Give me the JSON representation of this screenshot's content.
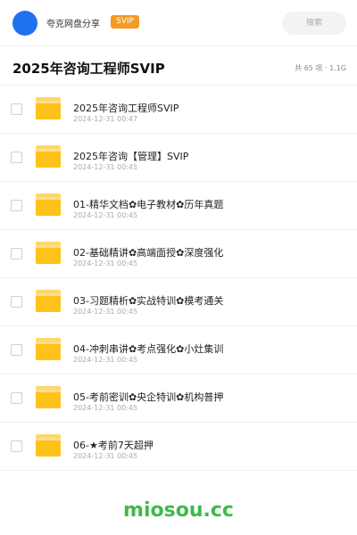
{
  "header": {
    "brand_name": "夸克网盘分享",
    "vip_badge": "SVIP",
    "search_label": "搜索"
  },
  "title_row": {
    "title": "2025年咨询工程师SVIP",
    "meta": "共 65 项 · 1.1G"
  },
  "files": [
    {
      "name": "2025年咨询工程师SVIP",
      "date": "2024-12-31 00:47"
    },
    {
      "name": "2025年咨询【管理】SVIP",
      "date": "2024-12-31 00:45"
    },
    {
      "name": "01-精华文档✿电子教材✿历年真题",
      "date": "2024-12-31 00:45"
    },
    {
      "name": "02-基础精讲✿高端面授✿深度强化",
      "date": "2024-12-31 00:45"
    },
    {
      "name": "03-习题精析✿实战特训✿模考通关",
      "date": "2024-12-31 00:45"
    },
    {
      "name": "04-冲刺串讲✿考点强化✿小灶集训",
      "date": "2024-12-31 00:45"
    },
    {
      "name": "05-考前密训✿央企特训✿机构普押",
      "date": "2024-12-31 00:45"
    },
    {
      "name": "06-★考前7天超押",
      "date": "2024-12-31 00:45"
    }
  ],
  "watermark": "miosou.cc",
  "colors": {
    "accent_blue": "#1e72f0",
    "vip_orange": "#f59a23",
    "folder_yellow": "#ffc21a",
    "watermark_green": "#3fb94a"
  }
}
